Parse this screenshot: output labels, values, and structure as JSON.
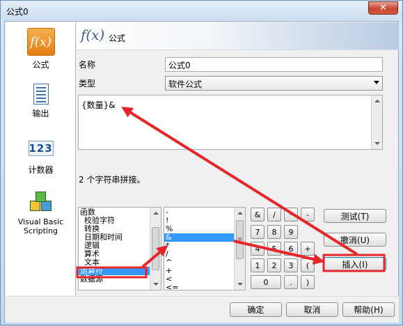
{
  "window": {
    "title": "公式0",
    "close_glyph": "✕"
  },
  "nav": {
    "items": [
      {
        "label": "公式",
        "icon": "fx-icon",
        "glyph": "f(x)",
        "selected": true
      },
      {
        "label": "输出",
        "icon": "document-icon"
      },
      {
        "label": "计数器",
        "icon": "counter-icon",
        "glyph": "123"
      },
      {
        "label": "Visual Basic Scripting",
        "icon": "vbs-blocks-icon"
      }
    ]
  },
  "header": {
    "fx_glyph": "f(x)",
    "title": "公式"
  },
  "form": {
    "name_label": "名称",
    "name_value": "公式0",
    "type_label": "类型",
    "type_value": "软件公式",
    "formula_text": "{数量}&",
    "description": "2 个字符串拼接。"
  },
  "categories": [
    {
      "label": "函数",
      "indent": false
    },
    {
      "label": "校验字符",
      "indent": true
    },
    {
      "label": "转换",
      "indent": true
    },
    {
      "label": "日期和时间",
      "indent": true
    },
    {
      "label": "逻辑",
      "indent": true
    },
    {
      "label": "算术",
      "indent": true
    },
    {
      "label": "文本",
      "indent": true
    },
    {
      "label": "运算符",
      "indent": false,
      "selected": true
    },
    {
      "label": "数据源",
      "indent": false
    }
  ],
  "operators": [
    "-",
    "!",
    "%",
    "&",
    "*",
    "/",
    "^",
    "+",
    "<",
    "<="
  ],
  "operators_selected_index": 3,
  "operator_selected_marker": "≡",
  "keypad": [
    [
      "&",
      "/",
      "*",
      "-"
    ],
    [
      "7",
      "8",
      "9",
      ""
    ],
    [
      "4",
      "5",
      "6",
      "+"
    ],
    [
      "1",
      "2",
      "3",
      "("
    ],
    [
      "0",
      ".",
      ")"
    ]
  ],
  "actions": {
    "test": "测试(T)",
    "undo": "撤消(U)",
    "insert": "插入(I)"
  },
  "footer": {
    "ok": "确定",
    "cancel": "取消",
    "help": "帮助(H)"
  },
  "colors": {
    "annotation_red": "#e8262a",
    "selection_blue": "#3399ff",
    "selected_nav_orange": "#ef8e1f"
  }
}
